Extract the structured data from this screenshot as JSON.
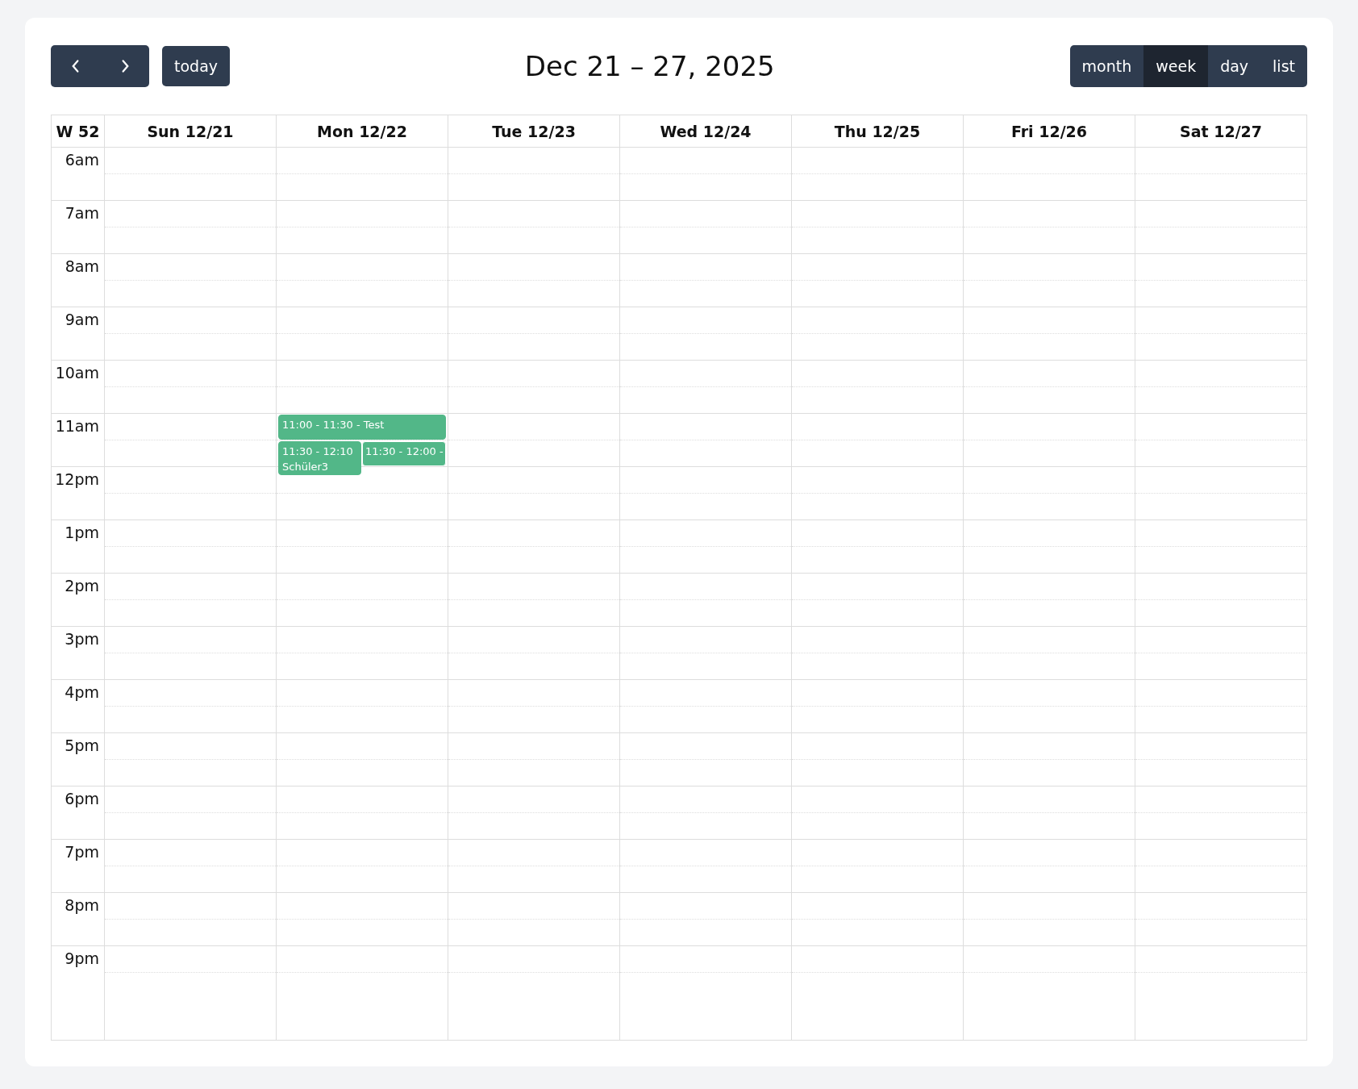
{
  "toolbar": {
    "nav": [
      {
        "kind": "prev"
      },
      {
        "kind": "next"
      }
    ],
    "today": "today",
    "title": "Dec 21 – 27, 2025",
    "views": [
      {
        "label": "month",
        "selected": false
      },
      {
        "label": "week",
        "selected": true
      },
      {
        "label": "day",
        "selected": false
      },
      {
        "label": "list",
        "selected": false
      }
    ]
  },
  "calendar": {
    "week_label": "W 52",
    "hours": [
      "6am",
      "7am",
      "8am",
      "9am",
      "10am",
      "11am",
      "12pm",
      "1pm",
      "2pm",
      "3pm",
      "4pm",
      "5pm",
      "6pm",
      "7pm",
      "8pm",
      "9pm"
    ],
    "days": [
      {
        "label": "Sun 12/21"
      },
      {
        "label": "Mon 12/22",
        "events": [
          {
            "kind": "base",
            "text": "11:00 - 11:30 - Test"
          },
          {
            "kind": "base",
            "text": "11:30 - 12:10 Schüler3"
          },
          {
            "kind": "stacked",
            "text": "11:30 - 12:00 -"
          }
        ]
      },
      {
        "label": "Tue 12/23"
      },
      {
        "label": "Wed 12/24"
      },
      {
        "label": "Thu 12/25"
      },
      {
        "label": "Fri 12/26"
      },
      {
        "label": "Sat 12/27"
      }
    ]
  }
}
